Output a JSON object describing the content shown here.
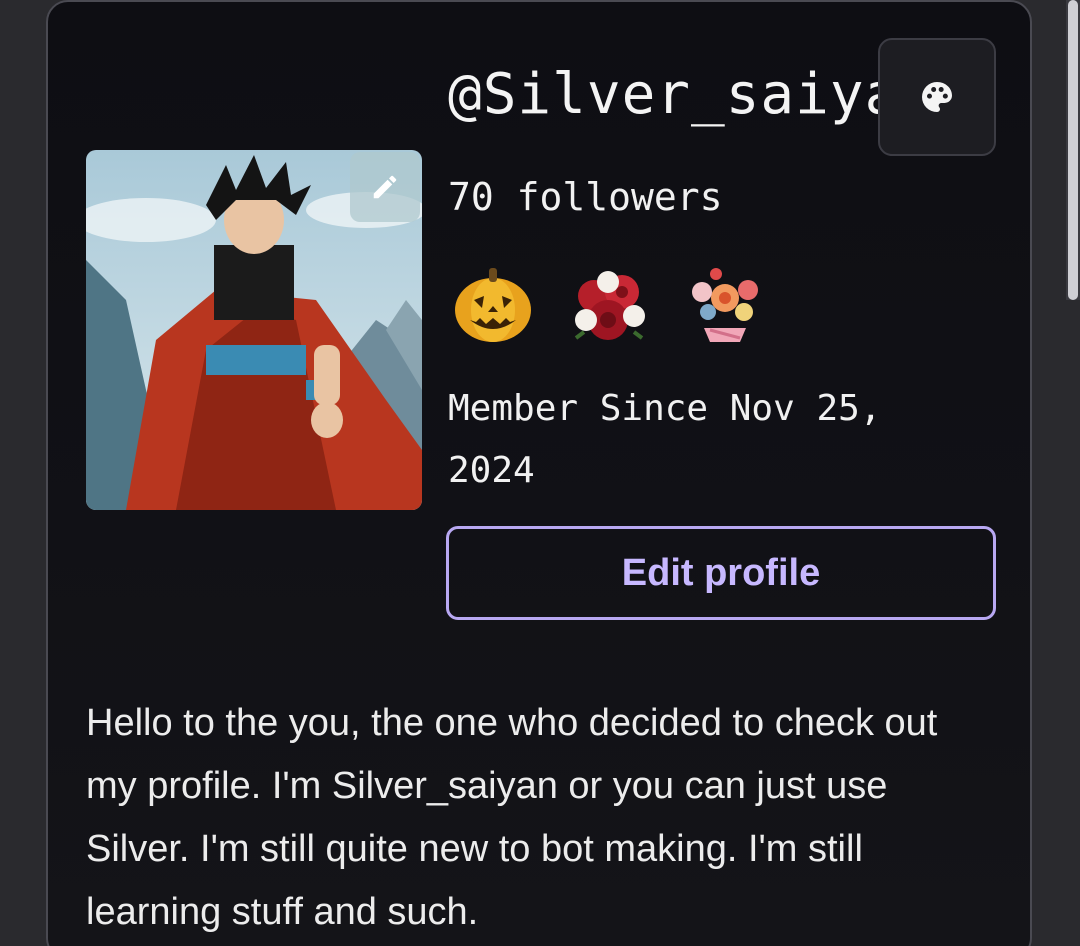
{
  "profile": {
    "username": "@Silver_saiyan",
    "followers": "70 followers",
    "member_since": "Member Since Nov 25, 2024",
    "badges": [
      {
        "icon": "jack-o-lantern-icon"
      },
      {
        "icon": "roses-bouquet-icon"
      },
      {
        "icon": "flower-bouquet-icon"
      }
    ],
    "edit_profile_label": "Edit profile",
    "bio": "Hello to the you, the one who decided to check out my profile. I'm Silver_saiyan or you can just use Silver. I'm still quite new to bot making. I'm still learning stuff and such."
  },
  "icons": {
    "theme_button": "palette-icon",
    "avatar_edit": "pencil-icon"
  },
  "colors": {
    "accent": "#c7b8ff",
    "accent_border": "#b8a8f2",
    "card_background": "#111116",
    "text": "#f1f1f1"
  }
}
